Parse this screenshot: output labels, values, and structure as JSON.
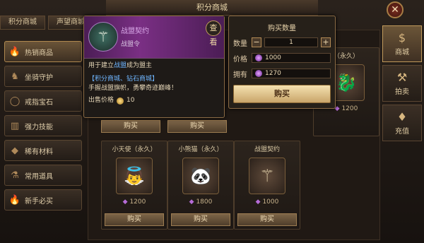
{
  "window": {
    "title": "积分商城",
    "close_glyph": "✕"
  },
  "top_tabs": [
    "积分商城",
    "声望商城"
  ],
  "sidebar": {
    "items": [
      {
        "label": "热销商品",
        "icon": "flame-icon",
        "active": true
      },
      {
        "label": "坐骑守护",
        "icon": "horse-icon",
        "active": false
      },
      {
        "label": "戒指宝石",
        "icon": "ring-icon",
        "active": false
      },
      {
        "label": "强力技能",
        "icon": "book-icon",
        "active": false
      },
      {
        "label": "稀有材料",
        "icon": "crystal-icon",
        "active": false
      },
      {
        "label": "常用道具",
        "icon": "potion-icon",
        "active": false
      },
      {
        "label": "新手必买",
        "icon": "flame-icon",
        "active": false
      }
    ]
  },
  "right_tabs": [
    {
      "label": "商城",
      "icon": "money-bag-icon",
      "active": true
    },
    {
      "label": "拍卖",
      "icon": "gavel-icon",
      "active": false
    },
    {
      "label": "充值",
      "icon": "diamond-icon",
      "active": false
    }
  ],
  "cards": [
    {
      "name": "（永久）",
      "price": "1200",
      "buy": "购买"
    },
    {
      "name": "小天使（永久）",
      "price": "1200",
      "buy": "购买"
    },
    {
      "name": "小熊猫（永久）",
      "price": "1800",
      "buy": "购买"
    },
    {
      "name": "战盟契约",
      "price": "1000",
      "buy": "购买"
    }
  ],
  "top_buy_labels": [
    "购买",
    "购买"
  ],
  "tooltip": {
    "name": "战盟契约",
    "sub": "战盟令",
    "search_label": "查看",
    "line1_prefix": "用于建立",
    "line1_highlight": "战盟",
    "line1_suffix": "成为盟主",
    "source": "【积分商城、钻石商城】",
    "flavor": "手握战盟旗帜，勇攀奇迹巅峰！",
    "sell_label": "出售价格",
    "sell_value": "10"
  },
  "buy_panel": {
    "title": "购买数量",
    "qty_label": "数量",
    "qty_value": "1",
    "minus": "−",
    "plus": "+",
    "price_label": "价格",
    "price_value": "1000",
    "own_label": "拥有",
    "own_value": "1270",
    "buy_label": "购买"
  },
  "colors": {
    "accent": "#c9a56a",
    "gem": "#b66cd8",
    "highlight_text": "#6fb6ff"
  }
}
